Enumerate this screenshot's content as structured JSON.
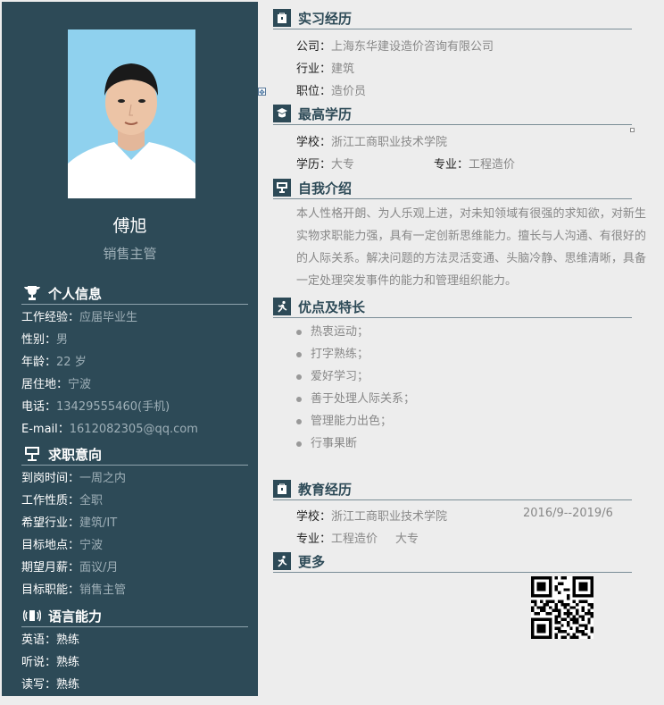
{
  "profile": {
    "name": "傅旭",
    "job_title": "销售主管"
  },
  "personal_info": {
    "heading": "个人信息",
    "rows": [
      {
        "label": "工作经验：",
        "value": "应届毕业生"
      },
      {
        "label": "性别：",
        "value": "男"
      },
      {
        "label": "年龄：",
        "value": "22 岁"
      },
      {
        "label": "居住地：",
        "value": "宁波"
      },
      {
        "label": "电话：",
        "value": "13429555460(手机)"
      },
      {
        "label": "E-mail：",
        "value": "1612082305@qq.com"
      }
    ]
  },
  "job_intent": {
    "heading": "求职意向",
    "rows": [
      {
        "label": "到岗时间：",
        "value": "一周之内"
      },
      {
        "label": "工作性质：",
        "value": "全职"
      },
      {
        "label": "希望行业：",
        "value": "建筑/IT"
      },
      {
        "label": "目标地点：",
        "value": "宁波"
      },
      {
        "label": "期望月薪：",
        "value": "面议/月"
      },
      {
        "label": "目标职能：",
        "value": "销售主管"
      }
    ]
  },
  "language": {
    "heading": "语言能力",
    "rows": [
      {
        "label": "英语：",
        "value": "熟练"
      },
      {
        "label": "听说：",
        "value": "熟练"
      },
      {
        "label": "读写：",
        "value": "熟练"
      }
    ]
  },
  "internship": {
    "heading": "实习经历",
    "company_label": "公司：",
    "company": "上海东华建设造价咨询有限公司",
    "industry_label": "行业：",
    "industry": "建筑",
    "position_label": "职位：",
    "position": "造价员"
  },
  "highest_edu": {
    "heading": "最高学历",
    "school_label": "学校：",
    "school": "浙江工商职业技术学院",
    "degree_label": "学历：",
    "degree": "大专",
    "major_label": "专业：",
    "major": "工程造价"
  },
  "self_intro": {
    "heading": "自我介绍",
    "text": "本人性格开朗、为人乐观上进，对未知领域有很强的求知欲，对新生实物求职能力强，具有一定创新思维能力。擅长与人沟通、有很好的的人际关系。解决问题的方法灵活变通、头脑冷静、思维清晰，具备一定处理突发事件的能力和管理组织能力。"
  },
  "strengths": {
    "heading": "优点及特长",
    "items": [
      "热衷运动；",
      "打字熟练；",
      "爱好学习；",
      "善于处理人际关系；",
      "管理能力出色；",
      "行事果断"
    ]
  },
  "education": {
    "heading": "教育经历",
    "school_label": "学校：",
    "school": "浙江工商职业技术学院",
    "period": "2016/9--2019/6",
    "major_label": "专业：",
    "major": "工程造价",
    "degree": "大专"
  },
  "more": {
    "heading": "更多"
  },
  "colors": {
    "sidebar_bg": "#2d4a57",
    "page_bg": "#ededed",
    "muted_text": "#888888"
  }
}
